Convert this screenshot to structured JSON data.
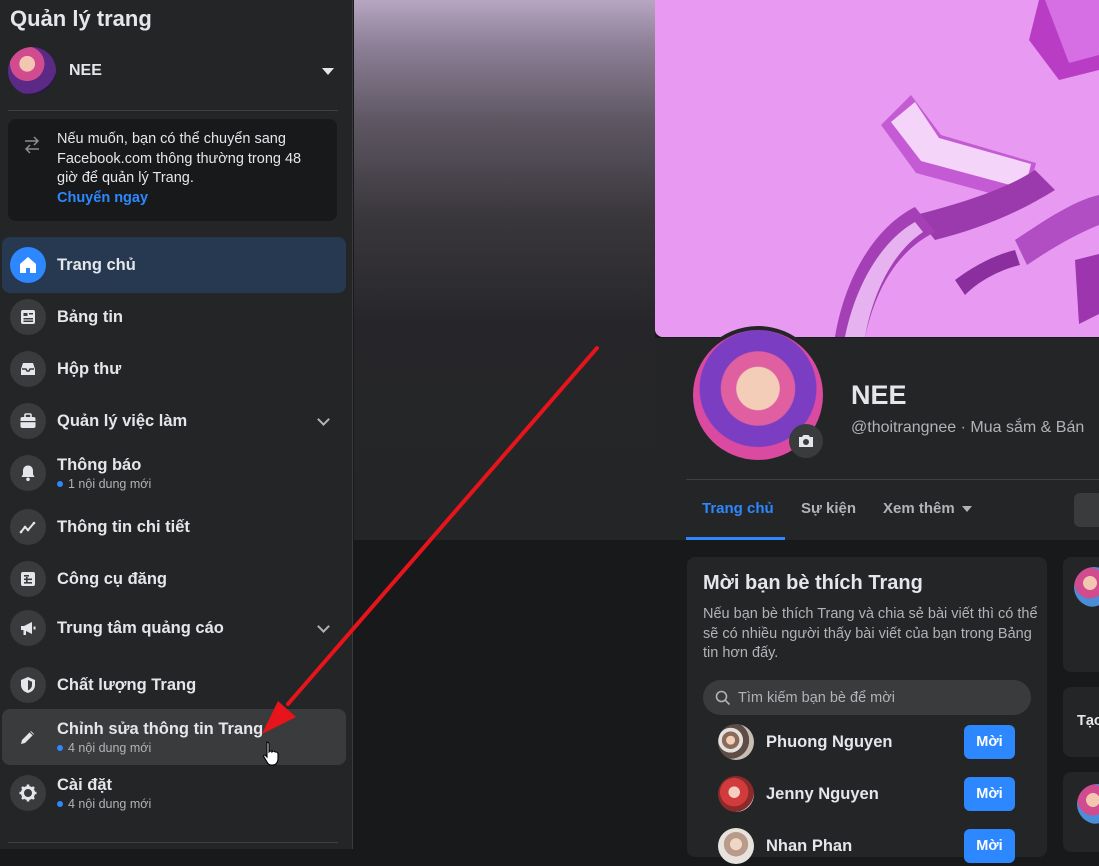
{
  "sidebar": {
    "title": "Quản lý trang",
    "page_name": "NEE",
    "notice": {
      "text": "Nếu muốn, bạn có thể chuyển sang Facebook.com thông thường trong 48 giờ để quản lý Trang.",
      "link": "Chuyển ngay"
    },
    "items": [
      {
        "label": "Trang chủ",
        "sub": null,
        "icon": "home-icon"
      },
      {
        "label": "Bảng tin",
        "sub": null,
        "icon": "news-feed-icon"
      },
      {
        "label": "Hộp thư",
        "sub": null,
        "icon": "inbox-icon"
      },
      {
        "label": "Quản lý việc làm",
        "sub": null,
        "icon": "briefcase-icon"
      },
      {
        "label": "Thông báo",
        "sub": "1 nội dung mới",
        "icon": "bell-icon"
      },
      {
        "label": "Thông tin chi tiết",
        "sub": null,
        "icon": "insights-icon"
      },
      {
        "label": "Công cụ đăng",
        "sub": null,
        "icon": "publishing-tools-icon"
      },
      {
        "label": "Trung tâm quảng cáo",
        "sub": null,
        "icon": "megaphone-icon"
      },
      {
        "label": "Chất lượng Trang",
        "sub": null,
        "icon": "shield-icon"
      },
      {
        "label": "Chỉnh sửa thông tin Trang",
        "sub": "4 nội dung mới",
        "icon": "pencil-icon"
      },
      {
        "label": "Cài đặt",
        "sub": "4 nội dung mới",
        "icon": "gear-icon"
      }
    ]
  },
  "profile": {
    "name": "NEE",
    "handle": "@thoitrangnee · Mua sắm & Bán"
  },
  "tabs": [
    {
      "label": "Trang chủ"
    },
    {
      "label": "Sự kiện"
    },
    {
      "label": "Xem thêm"
    }
  ],
  "invite": {
    "title": "Mời bạn bè thích Trang",
    "description": "Nếu bạn bè thích Trang và chia sẻ bài viết thì có thể sẽ có nhiều người thấy bài viết của bạn trong Bảng tin hơn đấy.",
    "search_placeholder": "Tìm kiếm bạn bè để mời",
    "button_label": "Mời",
    "friends": [
      {
        "name": "Phuong Nguyen"
      },
      {
        "name": "Jenny Nguyen"
      },
      {
        "name": "Nhan Phan"
      }
    ]
  },
  "side_card": {
    "partial_text": "Tạo"
  },
  "colors": {
    "accent": "#2d88ff",
    "annotation_arrow": "#e8141b"
  }
}
